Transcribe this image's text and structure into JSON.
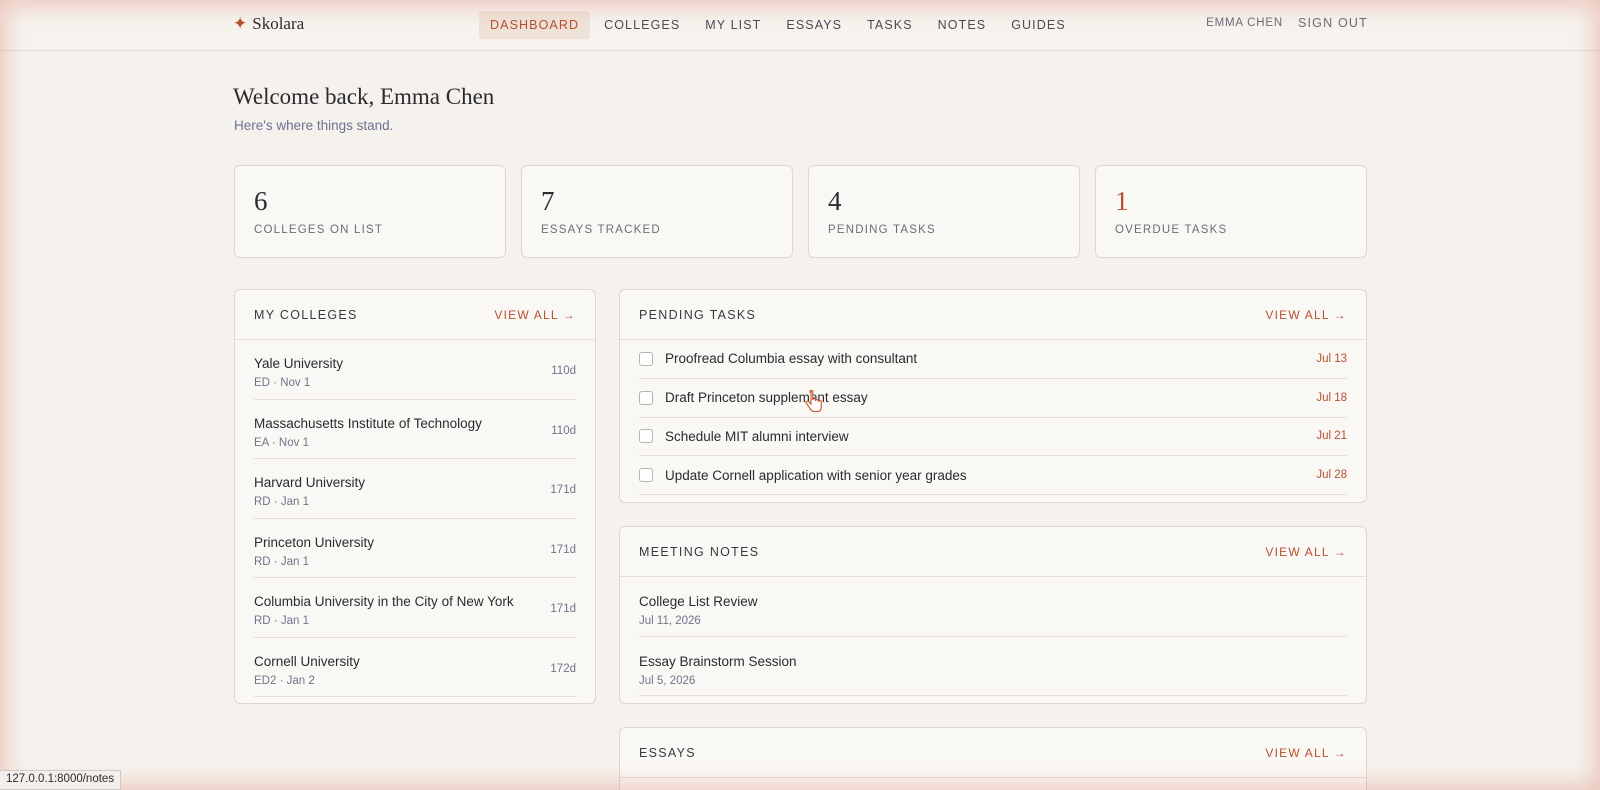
{
  "brand": {
    "icon": "sparkle-icon",
    "name": "Skolara"
  },
  "nav": {
    "items": [
      "DASHBOARD",
      "COLLEGES",
      "MY LIST",
      "ESSAYS",
      "TASKS",
      "NOTES",
      "GUIDES"
    ],
    "active": "DASHBOARD",
    "user": "EMMA CHEN",
    "signout": "SIGN OUT"
  },
  "header": {
    "title": "Welcome back, Emma Chen",
    "subtitle": "Here's where things stand."
  },
  "stats": [
    {
      "value": "6",
      "label": "COLLEGES ON LIST"
    },
    {
      "value": "7",
      "label": "ESSAYS TRACKED"
    },
    {
      "value": "4",
      "label": "PENDING TASKS"
    },
    {
      "value": "1",
      "label": "OVERDUE TASKS"
    }
  ],
  "colleges": {
    "title": "MY COLLEGES",
    "link": "VIEW ALL →",
    "items": [
      {
        "name": "Yale University",
        "meta": "ED · Nov 1",
        "days": "110d"
      },
      {
        "name": "Massachusetts Institute of Technology",
        "meta": "EA · Nov 1",
        "days": "110d"
      },
      {
        "name": "Harvard University",
        "meta": "RD · Jan 1",
        "days": "171d"
      },
      {
        "name": "Princeton University",
        "meta": "RD · Jan 1",
        "days": "171d"
      },
      {
        "name": "Columbia University in the City of New York",
        "meta": "RD · Jan 1",
        "days": "171d"
      },
      {
        "name": "Cornell University",
        "meta": "ED2 · Jan 2",
        "days": "172d"
      }
    ]
  },
  "tasks": {
    "title": "PENDING TASKS",
    "link": "VIEW ALL →",
    "items": [
      {
        "text": "Proofread Columbia essay with consultant",
        "date": "Jul 13"
      },
      {
        "text": "Draft Princeton supplement essay",
        "date": "Jul 18"
      },
      {
        "text": "Schedule MIT alumni interview",
        "date": "Jul 21"
      },
      {
        "text": "Update Cornell application with senior year grades",
        "date": "Jul 28"
      }
    ]
  },
  "notes": {
    "title": "MEETING NOTES",
    "link": "VIEW ALL →",
    "items": [
      {
        "title": "College List Review",
        "date": "Jul 11, 2026"
      },
      {
        "title": "Essay Brainstorm Session",
        "date": "Jul 5, 2026"
      }
    ]
  },
  "essays": {
    "title": "ESSAYS",
    "link": "VIEW ALL →"
  },
  "statusbar": {
    "url": "127.0.0.1:8000/notes"
  },
  "colors": {
    "accent": "#b5512f",
    "background": "#f5f2ed",
    "card": "#faf8f5",
    "muted": "#70748a"
  }
}
